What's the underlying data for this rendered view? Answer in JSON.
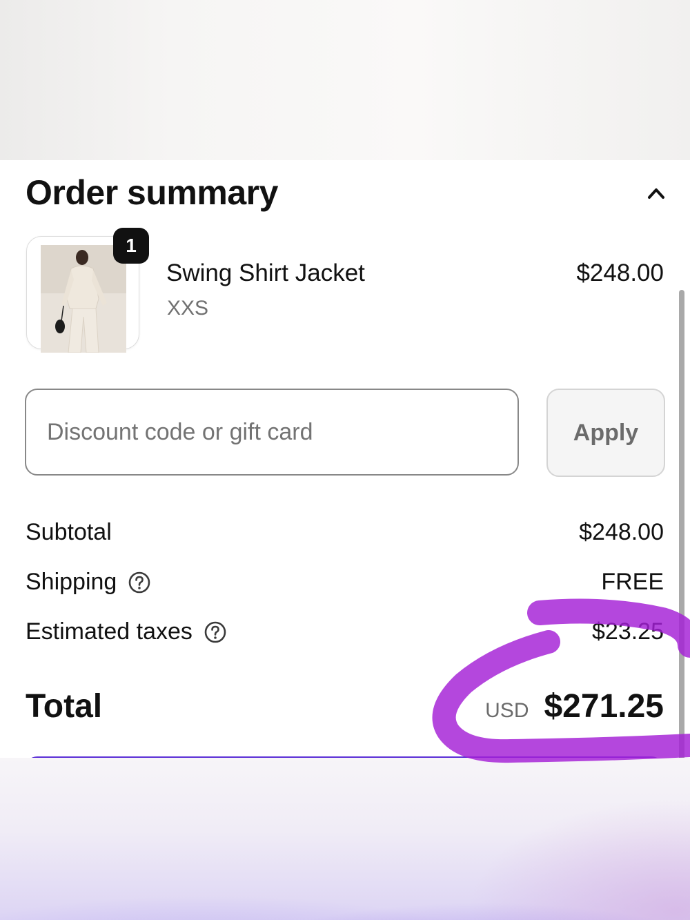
{
  "order_summary": {
    "title": "Order summary",
    "collapse_icon": "chevron-up-icon"
  },
  "line_item": {
    "quantity": "1",
    "name": "Swing Shirt Jacket",
    "variant": "XXS",
    "price": "$248.00"
  },
  "discount": {
    "placeholder": "Discount code or gift card",
    "value": "",
    "apply_label": "Apply"
  },
  "summary_lines": {
    "subtotal_label": "Subtotal",
    "subtotal_value": "$248.00",
    "shipping_label": "Shipping",
    "shipping_value": "FREE",
    "taxes_label": "Estimated taxes",
    "taxes_value": "$23.25",
    "help_icon": "question-circle-icon"
  },
  "total": {
    "label": "Total",
    "currency": "USD",
    "amount": "$271.25"
  },
  "colors": {
    "pay_button": "#5b2fd6",
    "annotation_marker": "#a31fd6",
    "text_primary": "#111111",
    "text_muted": "#707070"
  }
}
